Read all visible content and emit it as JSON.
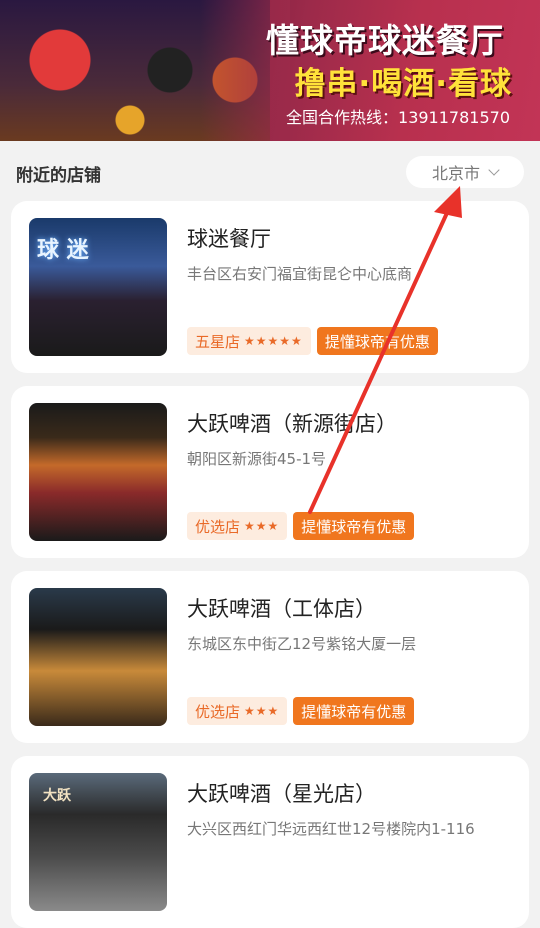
{
  "banner": {
    "title": "懂球帝球迷餐厅",
    "slogan": "撸串·喝酒·看球",
    "hotline": "全国合作热线：13911781570"
  },
  "section": {
    "title": "附近的店铺",
    "city": "北京市"
  },
  "shops": [
    {
      "name": "球迷餐厅",
      "address": "丰台区右安门福宜街昆仑中心底商",
      "tier": "五星店",
      "stars": "★★★★★",
      "promo": "提懂球帝有优惠",
      "sign": "球 迷"
    },
    {
      "name": "大跃啤酒（新源街店）",
      "address": "朝阳区新源街45-1号",
      "tier": "优选店",
      "stars": "★★★",
      "promo": "提懂球帝有优惠"
    },
    {
      "name": "大跃啤酒（工体店）",
      "address": "东城区东中街乙12号紫铭大厦一层",
      "tier": "优选店",
      "stars": "★★★",
      "promo": "提懂球帝有优惠"
    },
    {
      "name": "大跃啤酒（星光店）",
      "address": "大兴区西红门华远西红世12号楼院内1-116",
      "sign": "大跃"
    }
  ]
}
